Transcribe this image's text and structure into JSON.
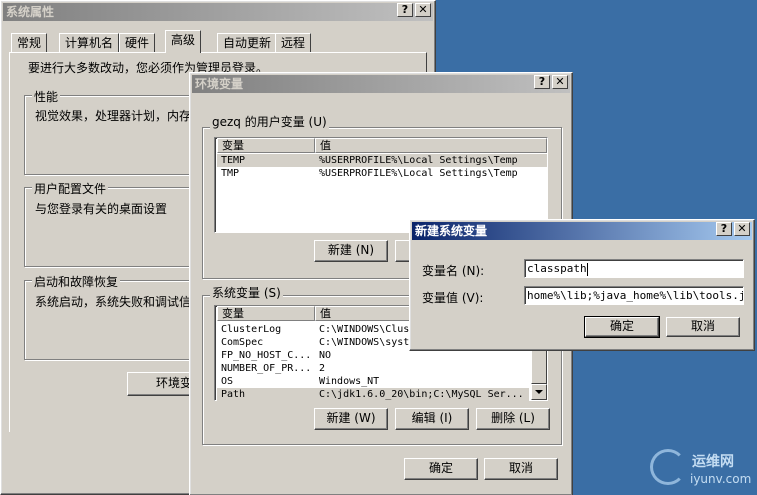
{
  "sysprops": {
    "title": "系统属性",
    "tabs": [
      "常规",
      "计算机名",
      "硬件",
      "高级",
      "自动更新",
      "远程"
    ],
    "admin_note": "要进行大多数改动，您必须作为管理员登录。",
    "perf_group": "性能",
    "perf_desc": "视觉效果，处理器计划，内存",
    "profile_group": "用户配置文件",
    "profile_desc": "与您登录有关的桌面设置",
    "startup_group": "启动和故障恢复",
    "startup_desc": "系统启动，系统失败和调试信",
    "envvar_button": "环境变"
  },
  "envvars": {
    "title": "环境变量",
    "user_group": "gezq 的用户变量 (U)",
    "col_var": "变量",
    "col_val": "值",
    "user_rows": [
      {
        "name": "TEMP",
        "value": "%USERPROFILE%\\Local Settings\\Temp"
      },
      {
        "name": "TMP",
        "value": "%USERPROFILE%\\Local Settings\\Temp"
      }
    ],
    "user_new_button": "新建 (N)",
    "sys_group": "系统变量 (S)",
    "sys_rows": [
      {
        "name": "ClusterLog",
        "value": "C:\\WINDOWS\\Clus"
      },
      {
        "name": "ComSpec",
        "value": "C:\\WINDOWS\\syst"
      },
      {
        "name": "FP_NO_HOST_C...",
        "value": "NO"
      },
      {
        "name": "NUMBER_OF_PR...",
        "value": "2"
      },
      {
        "name": "OS",
        "value": "Windows_NT"
      },
      {
        "name": "Path",
        "value": "C:\\jdk1.6.0_20\\bin;C:\\MySQL Ser..."
      }
    ],
    "sys_new_button": "新建 (W)",
    "sys_edit_button": "编辑 (I)",
    "sys_delete_button": "删除 (L)",
    "ok_button": "确定",
    "cancel_button": "取消"
  },
  "newvar": {
    "title": "新建系统变量",
    "name_label": "变量名 (N):",
    "name_value": "classpath",
    "value_label": "变量值 (V):",
    "value_value": "home%\\lib;%java_home%\\lib\\tools.jar",
    "ok_button": "确定",
    "cancel_button": "取消"
  },
  "titlebar_buttons": {
    "help": "?",
    "close": "✕"
  },
  "watermark": {
    "text": "运维网",
    "url": "iyunv.com"
  }
}
